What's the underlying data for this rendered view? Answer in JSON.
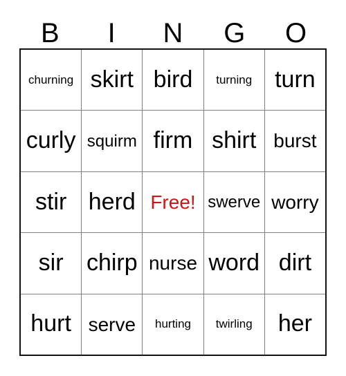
{
  "header": {
    "letters": [
      "B",
      "I",
      "N",
      "G",
      "O"
    ]
  },
  "grid": {
    "rows": [
      [
        {
          "text": "churning",
          "size": "xs",
          "free": false
        },
        {
          "text": "skirt",
          "size": "lg",
          "free": false
        },
        {
          "text": "bird",
          "size": "lg",
          "free": false
        },
        {
          "text": "turning",
          "size": "xs",
          "free": false
        },
        {
          "text": "turn",
          "size": "lg",
          "free": false
        }
      ],
      [
        {
          "text": "curly",
          "size": "lg",
          "free": false
        },
        {
          "text": "squirm",
          "size": "sm",
          "free": false
        },
        {
          "text": "firm",
          "size": "lg",
          "free": false
        },
        {
          "text": "shirt",
          "size": "lg",
          "free": false
        },
        {
          "text": "burst",
          "size": "md",
          "free": false
        }
      ],
      [
        {
          "text": "stir",
          "size": "lg",
          "free": false
        },
        {
          "text": "herd",
          "size": "lg",
          "free": false
        },
        {
          "text": "Free!",
          "size": "md",
          "free": true
        },
        {
          "text": "swerve",
          "size": "sm",
          "free": false
        },
        {
          "text": "worry",
          "size": "md",
          "free": false
        }
      ],
      [
        {
          "text": "sir",
          "size": "lg",
          "free": false
        },
        {
          "text": "chirp",
          "size": "lg",
          "free": false
        },
        {
          "text": "nurse",
          "size": "md",
          "free": false
        },
        {
          "text": "word",
          "size": "lg",
          "free": false
        },
        {
          "text": "dirt",
          "size": "lg",
          "free": false
        }
      ],
      [
        {
          "text": "hurt",
          "size": "lg",
          "free": false
        },
        {
          "text": "serve",
          "size": "md",
          "free": false
        },
        {
          "text": "hurting",
          "size": "xs",
          "free": false
        },
        {
          "text": "twirling",
          "size": "xs",
          "free": false
        },
        {
          "text": "her",
          "size": "lg",
          "free": false
        }
      ]
    ]
  },
  "colors": {
    "free_text": "#cc1515",
    "outer_border": "#111111",
    "inner_border": "#808080",
    "background": "#ffffff",
    "text": "#000000"
  }
}
